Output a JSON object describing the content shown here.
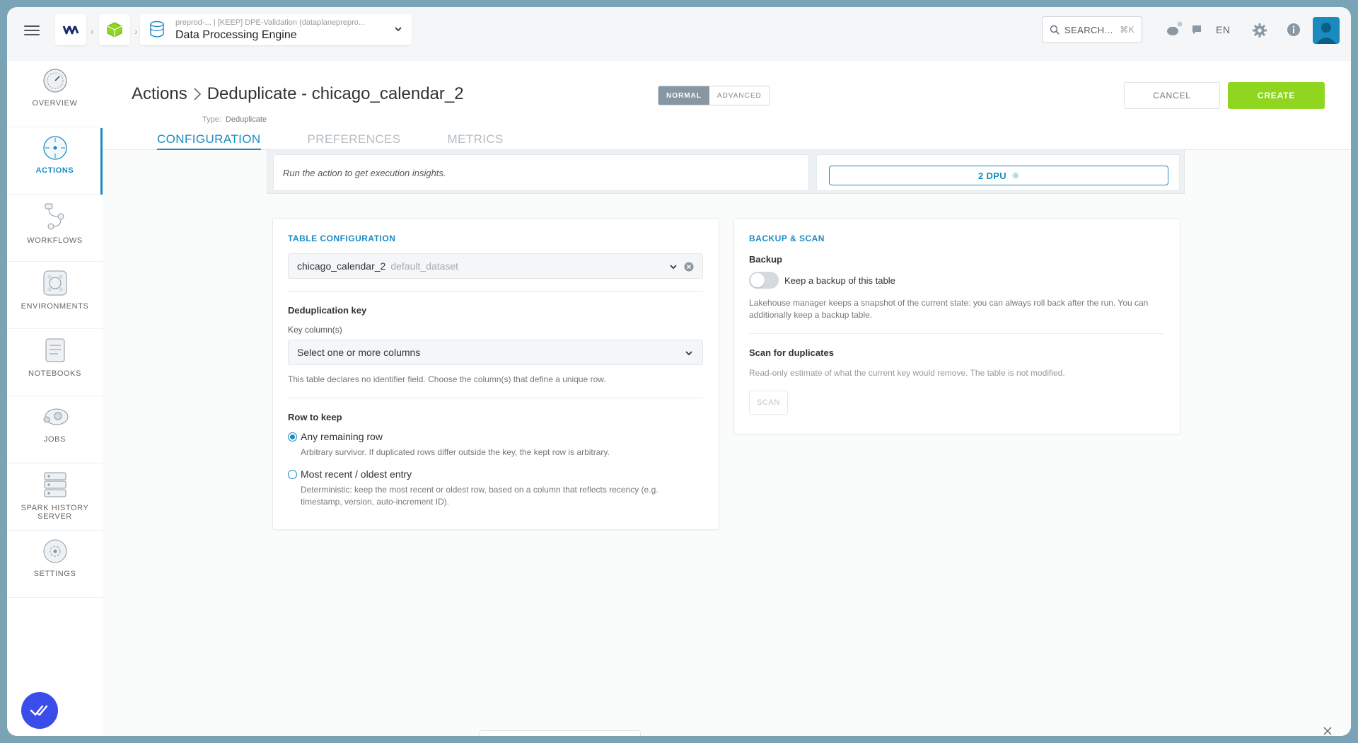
{
  "topbar": {
    "app_sub": "preprod-...   | [KEEP] DPE-Validation (dataplanepreprо...",
    "app_name": "Data Processing Engine",
    "search_label": "SEARCH...",
    "search_shortcut": "⌘K",
    "language": "EN"
  },
  "sidebar": {
    "items": [
      {
        "label": "OVERVIEW",
        "icon": "overview-icon"
      },
      {
        "label": "ACTIONS",
        "icon": "actions-icon",
        "active": true
      },
      {
        "label": "WORKFLOWS",
        "icon": "workflows-icon"
      },
      {
        "label": "ENVIRONMENTS",
        "icon": "environments-icon"
      },
      {
        "label": "NOTEBOOKS",
        "icon": "notebooks-icon"
      },
      {
        "label": "JOBS",
        "icon": "jobs-icon"
      },
      {
        "label": "SPARK HISTORY SERVER",
        "icon": "spark-history-icon"
      },
      {
        "label": "SETTINGS",
        "icon": "settings-icon"
      }
    ]
  },
  "header": {
    "breadcrumb_root": "Actions",
    "title": "Deduplicate - chicago_calendar_2",
    "type_label": "Type:",
    "type_value": "Deduplicate",
    "mode_normal": "NORMAL",
    "mode_advanced": "ADVANCED",
    "cancel_label": "CANCEL",
    "create_label": "CREATE",
    "tabs": [
      "CONFIGURATION",
      "PREFERENCES",
      "METRICS"
    ]
  },
  "insights": {
    "message": "Run the action to get execution insights.",
    "dpu": "2 DPU"
  },
  "table_config": {
    "title": "TABLE CONFIGURATION",
    "table_name": "chicago_calendar_2",
    "dataset": "default_dataset",
    "dedup_key_label": "Deduplication key",
    "key_columns_label": "Key column(s)",
    "key_columns_placeholder": "Select one or more columns",
    "key_helper": "This table declares no identifier field. Choose the column(s) that define a unique row.",
    "row_to_keep_label": "Row to keep",
    "option_any": "Any remaining row",
    "option_any_helper": "Arbitrary survivor. If duplicated rows differ outside the key, the kept row is arbitrary.",
    "option_recent": "Most recent / oldest entry",
    "option_recent_helper_1": "Deterministic: keep the most recent or oldest row, based on a column that reflects recency (e.g.",
    "option_recent_helper_2": "timestamp, version, auto-increment ID)."
  },
  "backup_scan": {
    "title": "BACKUP & SCAN",
    "backup_label": "Backup",
    "backup_toggle_label": "Keep a backup of this table",
    "backup_helper_1": "Lakehouse manager keeps a snapshot of the current state: you can always roll back after the run. You can",
    "backup_helper_2": "additionally keep a backup table.",
    "scan_label": "Scan for duplicates",
    "scan_helper": "Read-only estimate of what the current key would remove. The table is not modified.",
    "scan_button": "SCAN"
  },
  "colors": {
    "accent": "#1a8bbf",
    "create": "#8ed61f",
    "fab": "#3b4de8"
  }
}
